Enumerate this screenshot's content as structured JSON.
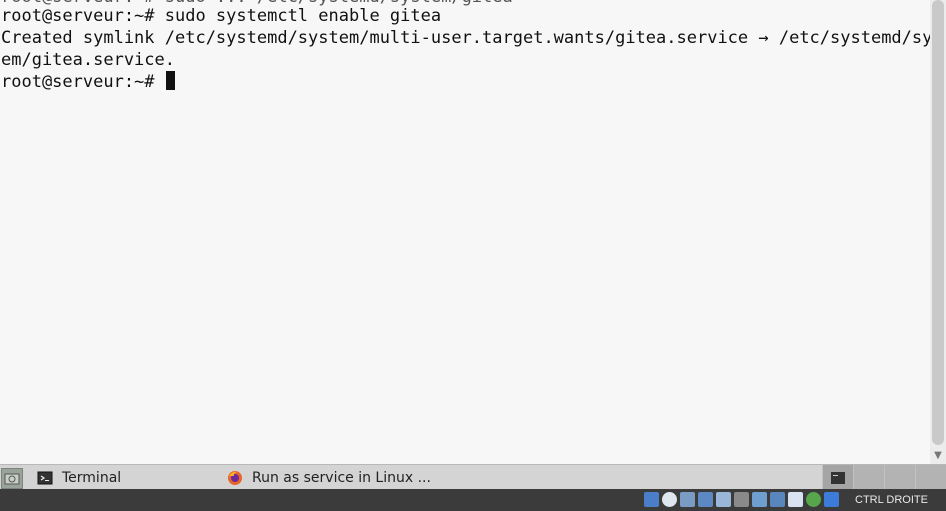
{
  "terminal": {
    "lines": {
      "partial": "root@serveur:~# sudo ... /etc/systemd/system/gitea",
      "cmd": "root@serveur:~# sudo systemctl enable gitea",
      "out1": "Created symlink /etc/systemd/system/multi-user.target.wants/gitea.service → /etc/systemd/syst",
      "out2": "em/gitea.service.",
      "prompt": "root@serveur:~# "
    }
  },
  "taskbar": {
    "tasks": [
      {
        "label": "Terminal",
        "icon": "terminal-icon"
      },
      {
        "label": "Run as service in Linux ...",
        "icon": "firefox-icon"
      }
    ]
  },
  "vbox_status": {
    "host_key": "CTRL DROITE",
    "icons": [
      "hard-disk-icon",
      "optical-drive-icon",
      "audio-icon",
      "network-icon",
      "usb-icon",
      "shared-folder-icon",
      "display-icon",
      "video-capture-icon",
      "virtualization-icon",
      "guest-additions-icon",
      "arrow-down-icon"
    ]
  },
  "colors": {
    "terminal_bg": "#f7f7f7",
    "taskbar_bg": "#d4d4d4",
    "statusbar_bg": "#3b3b3b"
  }
}
